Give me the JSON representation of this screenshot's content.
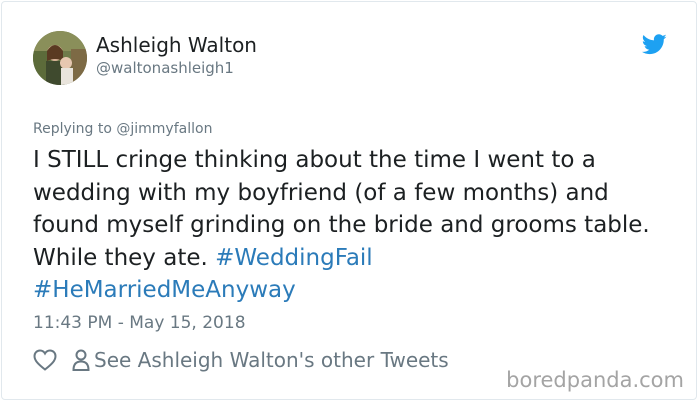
{
  "author": {
    "name": "Ashleigh Walton",
    "handle": "@waltonashleigh1"
  },
  "icons": {
    "platform": "twitter-bird-icon",
    "like": "heart-icon",
    "profile": "person-icon",
    "platform_color": "#1da1f2"
  },
  "tweet": {
    "replying_to": "Replying to @jimmyfallon",
    "text": "I STILL cringe thinking about the time I went to a wedding with my boyfriend (of a few months) and found myself grinding on the bride and grooms table. While they ate.",
    "hashtag_1": "#WeddingFail",
    "hashtag_2": "#HeMarriedMeAnyway",
    "timestamp": "11:43 PM - May 15, 2018"
  },
  "actions": {
    "see_other_tweets": "See Ashleigh Walton's other Tweets"
  },
  "watermark": "boredpanda.com",
  "colors": {
    "link": "#2b7bb9",
    "text": "#1c2022",
    "muted": "#697882"
  }
}
